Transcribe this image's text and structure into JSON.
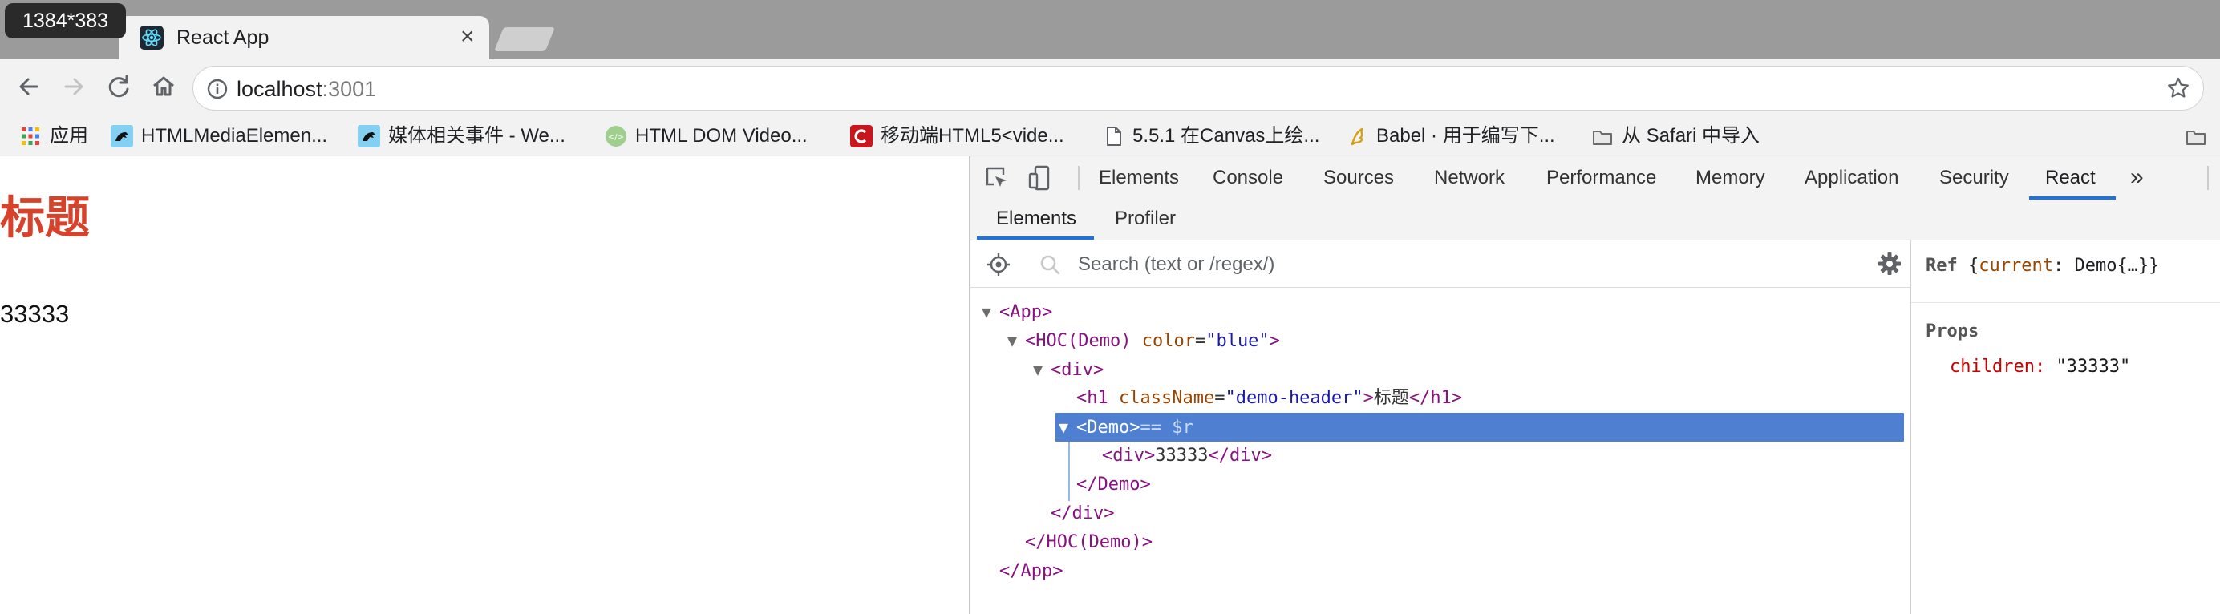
{
  "overlay": {
    "dimension_badge": "1384*383"
  },
  "browser": {
    "tab": {
      "title": "React App",
      "close_glyph": "×",
      "favicon": "react-logo-icon"
    },
    "toolbar": {
      "back": "arrow-left-icon",
      "forward": "arrow-right-icon",
      "reload": "reload-icon",
      "home": "home-icon",
      "url_host": "localhost",
      "url_port": ":3001",
      "bookmark_star": "star-icon"
    },
    "bookmarks": [
      {
        "label": "应用",
        "icon": "apps-grid-icon"
      },
      {
        "label": "HTMLMediaElemen...",
        "icon": "mdn-dino-icon"
      },
      {
        "label": "媒体相关事件 - We...",
        "icon": "mdn-dino-icon"
      },
      {
        "label": "HTML DOM Video...",
        "icon": "w3schools-icon"
      },
      {
        "label": "移动端HTML5<vide...",
        "icon": "csdn-icon"
      },
      {
        "label": "5.5.1 在Canvas上绘...",
        "icon": "document-icon"
      },
      {
        "label": "Babel · 用于编写下...",
        "icon": "babel-icon"
      },
      {
        "label": "从 Safari 中导入",
        "icon": "folder-icon"
      }
    ]
  },
  "page": {
    "heading": "标题",
    "heading_color": "#d8422a",
    "text": "33333"
  },
  "devtools": {
    "tabs": [
      {
        "label": "Elements"
      },
      {
        "label": "Console"
      },
      {
        "label": "Sources"
      },
      {
        "label": "Network"
      },
      {
        "label": "Performance"
      },
      {
        "label": "Memory"
      },
      {
        "label": "Application"
      },
      {
        "label": "Security"
      },
      {
        "label": "React",
        "active": true
      }
    ],
    "more_tabs_glyph": "»",
    "subtabs": [
      {
        "label": "Elements",
        "active": true
      },
      {
        "label": "Profiler"
      }
    ],
    "search_placeholder": "Search (text or /regex/)",
    "accent_color": "#1a73e8",
    "selection_color": "#4f7fd0",
    "tree": {
      "app_tag": "App",
      "hoc_tag": "HOC(Demo)",
      "hoc_attr_name": "color",
      "hoc_attr_value": "\"blue\"",
      "div_tag": "div",
      "h1_tag": "h1",
      "h1_attr_name": "className",
      "h1_attr_value": "\"demo-header\"",
      "h1_text": "标题",
      "demo_tag": "Demo",
      "demo_ref_suffix": "== $r",
      "inner_div_text": "33333"
    },
    "side_panel": {
      "ref_label": "Ref",
      "ref_open": "{",
      "ref_key": "current",
      "ref_value": ": Demo{…}}",
      "props_title": "Props",
      "prop_key": "children",
      "prop_value": "\"33333\""
    }
  }
}
